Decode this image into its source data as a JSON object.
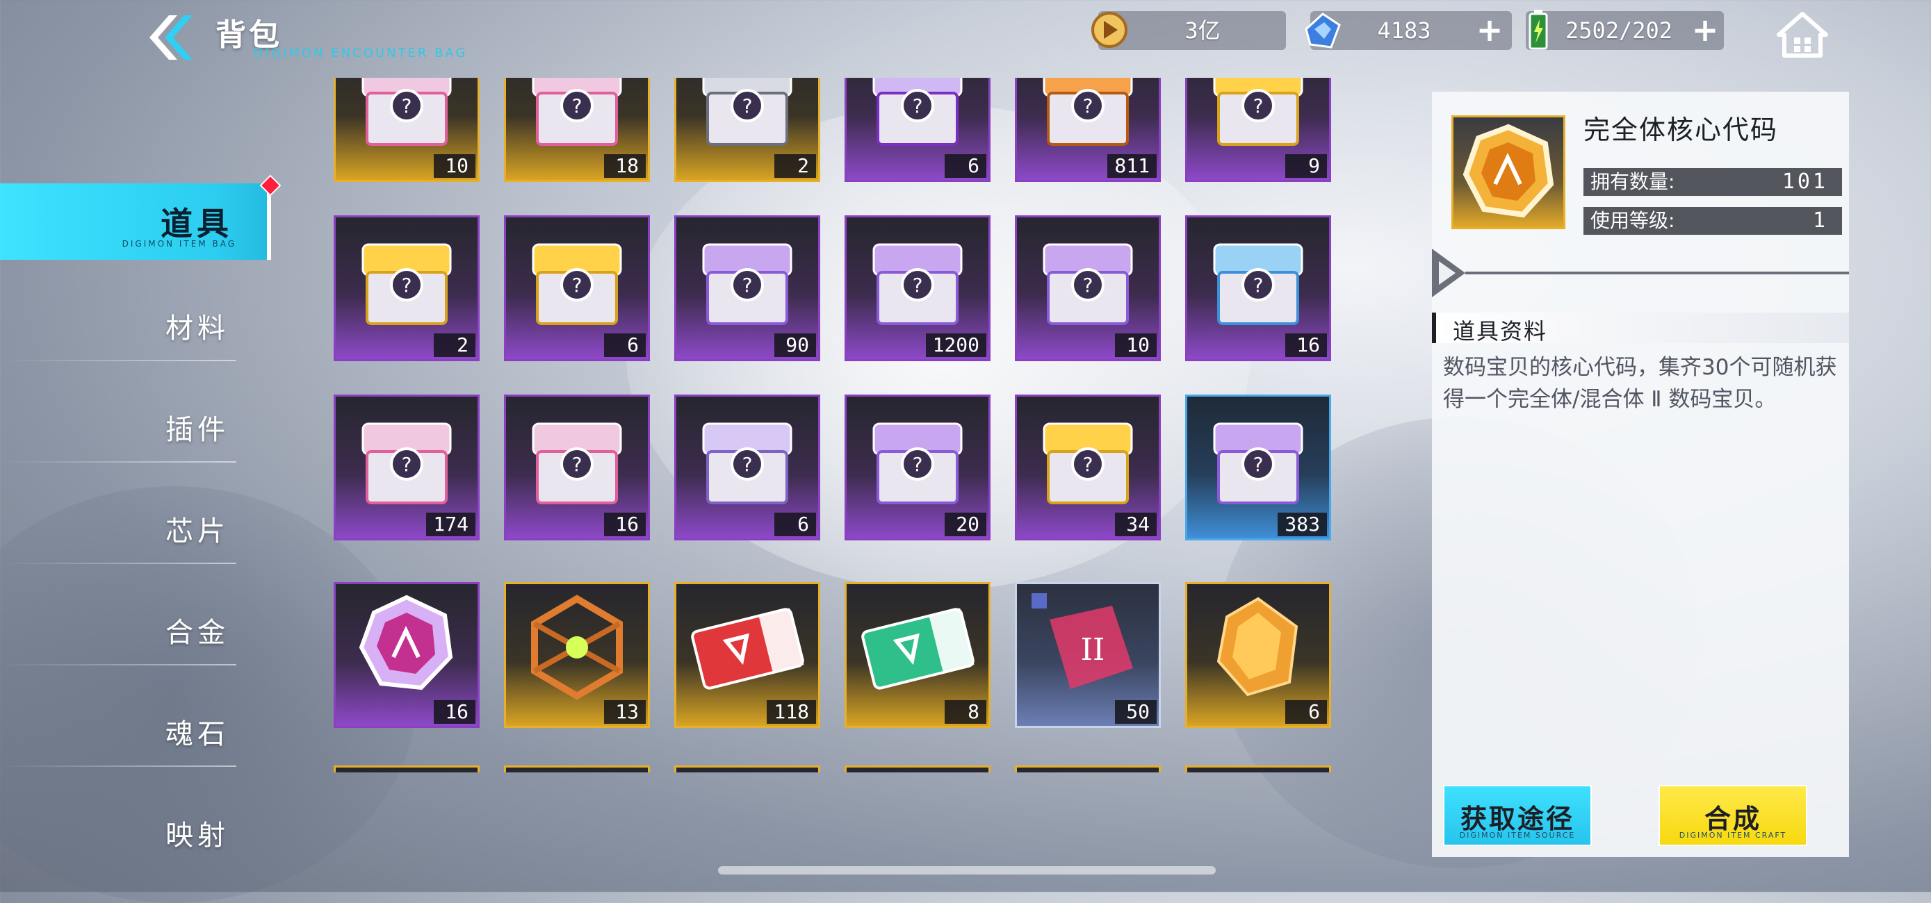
{
  "header": {
    "title": "背包",
    "subtitle": "DIGIMON ENCOUNTER BAG"
  },
  "resources": [
    {
      "name": "gold-coin",
      "value": "3亿",
      "has_plus": false
    },
    {
      "name": "blue-crystal",
      "value": "4183",
      "has_plus": true
    },
    {
      "name": "stamina",
      "value": "2502/202",
      "has_plus": true
    }
  ],
  "categories": [
    {
      "label": "道具",
      "active": true,
      "has_badge": true
    },
    {
      "label": "材料",
      "active": false
    },
    {
      "label": "插件",
      "active": false
    },
    {
      "label": "芯片",
      "active": false
    },
    {
      "label": "合金",
      "active": false
    },
    {
      "label": "魂石",
      "active": false
    },
    {
      "label": "映射",
      "active": false
    }
  ],
  "active_category_subtitle": "DIGIMON ITEM BAG",
  "items": [
    {
      "icon": "pink-mystery-box-icon",
      "rarity": "gold",
      "count": "10"
    },
    {
      "icon": "pink-mystery-box-icon",
      "rarity": "gold",
      "count": "18"
    },
    {
      "icon": "silver-chip-box-icon",
      "rarity": "gold",
      "count": "2"
    },
    {
      "icon": "purple-play-box-icon",
      "rarity": "purple",
      "count": "6"
    },
    {
      "icon": "orange-crown-box-icon",
      "rarity": "purple",
      "count": "811"
    },
    {
      "icon": "gold-basket-box-icon",
      "rarity": "purple",
      "count": "9"
    },
    {
      "icon": "gold-basket-box-icon",
      "rarity": "purple",
      "count": "2"
    },
    {
      "icon": "gold-basket-box-icon",
      "rarity": "purple",
      "count": "6"
    },
    {
      "icon": "purple-mystery-box-icon",
      "rarity": "purple",
      "count": "90"
    },
    {
      "icon": "purple-mystery-box-icon",
      "rarity": "purple",
      "count": "1200"
    },
    {
      "icon": "purple-mystery-box-icon",
      "rarity": "purple",
      "count": "10"
    },
    {
      "icon": "blue-mystery-box-icon",
      "rarity": "purple",
      "count": "16"
    },
    {
      "icon": "pink-mystery-box-icon",
      "rarity": "purple",
      "count": "174"
    },
    {
      "icon": "pink-mystery-box-icon",
      "rarity": "purple",
      "count": "16"
    },
    {
      "icon": "lens-box-icon",
      "rarity": "purple",
      "count": "6"
    },
    {
      "icon": "purple-mystery-box-icon",
      "rarity": "purple",
      "count": "20"
    },
    {
      "icon": "gold-basket-box-icon",
      "rarity": "purple",
      "count": "34"
    },
    {
      "icon": "purple-mystery-box-icon",
      "rarity": "blue",
      "count": "383"
    },
    {
      "icon": "purple-core-code-icon",
      "rarity": "purple",
      "count": "16"
    },
    {
      "icon": "orange-cube-frame-icon",
      "rarity": "gold",
      "count": "13"
    },
    {
      "icon": "red-ticket-icon",
      "rarity": "gold",
      "count": "118"
    },
    {
      "icon": "green-ticket-icon",
      "rarity": "gold",
      "count": "8"
    },
    {
      "icon": "puzzle-fragment-icon",
      "rarity": "silver",
      "count": "50"
    },
    {
      "icon": "amber-crystal-icon",
      "rarity": "gold",
      "count": "6"
    }
  ],
  "detail": {
    "icon": "gold-core-code-icon",
    "name": "完全体核心代码",
    "owned_label": "拥有数量:",
    "owned_value": "101",
    "level_label": "使用等级:",
    "level_value": "1",
    "section_title": "道具资料",
    "description": "数码宝贝的核心代码，集齐30个可随机获得一个完全体/混合体 Ⅱ 数码宝贝。",
    "buttons": {
      "obtain": "获取途径",
      "obtain_sub": "DIGIMON ITEM SOURCE",
      "synthesize": "合成",
      "synthesize_sub": "DIGIMON ITEM CRAFT"
    }
  },
  "colors": {
    "accent_cyan": "#2ccdf0",
    "rarity_purple": "#8b3fc2",
    "rarity_gold": "#e8b02a",
    "rarity_blue": "#4aa8e8",
    "button_yellow": "#f7d90f",
    "badge_red": "#ff1f3d"
  }
}
